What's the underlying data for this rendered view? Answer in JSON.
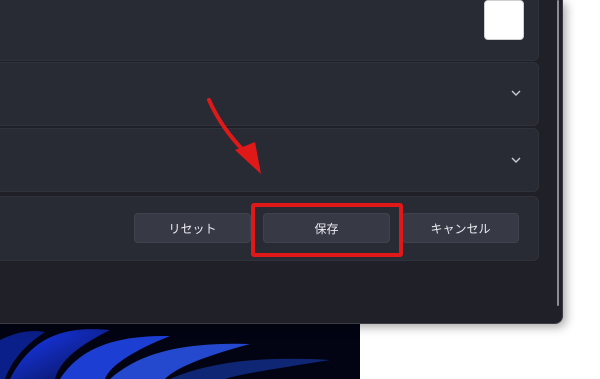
{
  "buttons": {
    "reset_label": "リセット",
    "save_label": "保存",
    "cancel_label": "キャンセル"
  },
  "color_picker": {
    "selected_color": "#ffffff"
  },
  "annotation": {
    "highlight_color": "#e11818"
  },
  "icons": {
    "dropdown_1": "chevron-down-icon",
    "dropdown_2": "chevron-down-icon",
    "pointer": "red-arrow-icon"
  }
}
